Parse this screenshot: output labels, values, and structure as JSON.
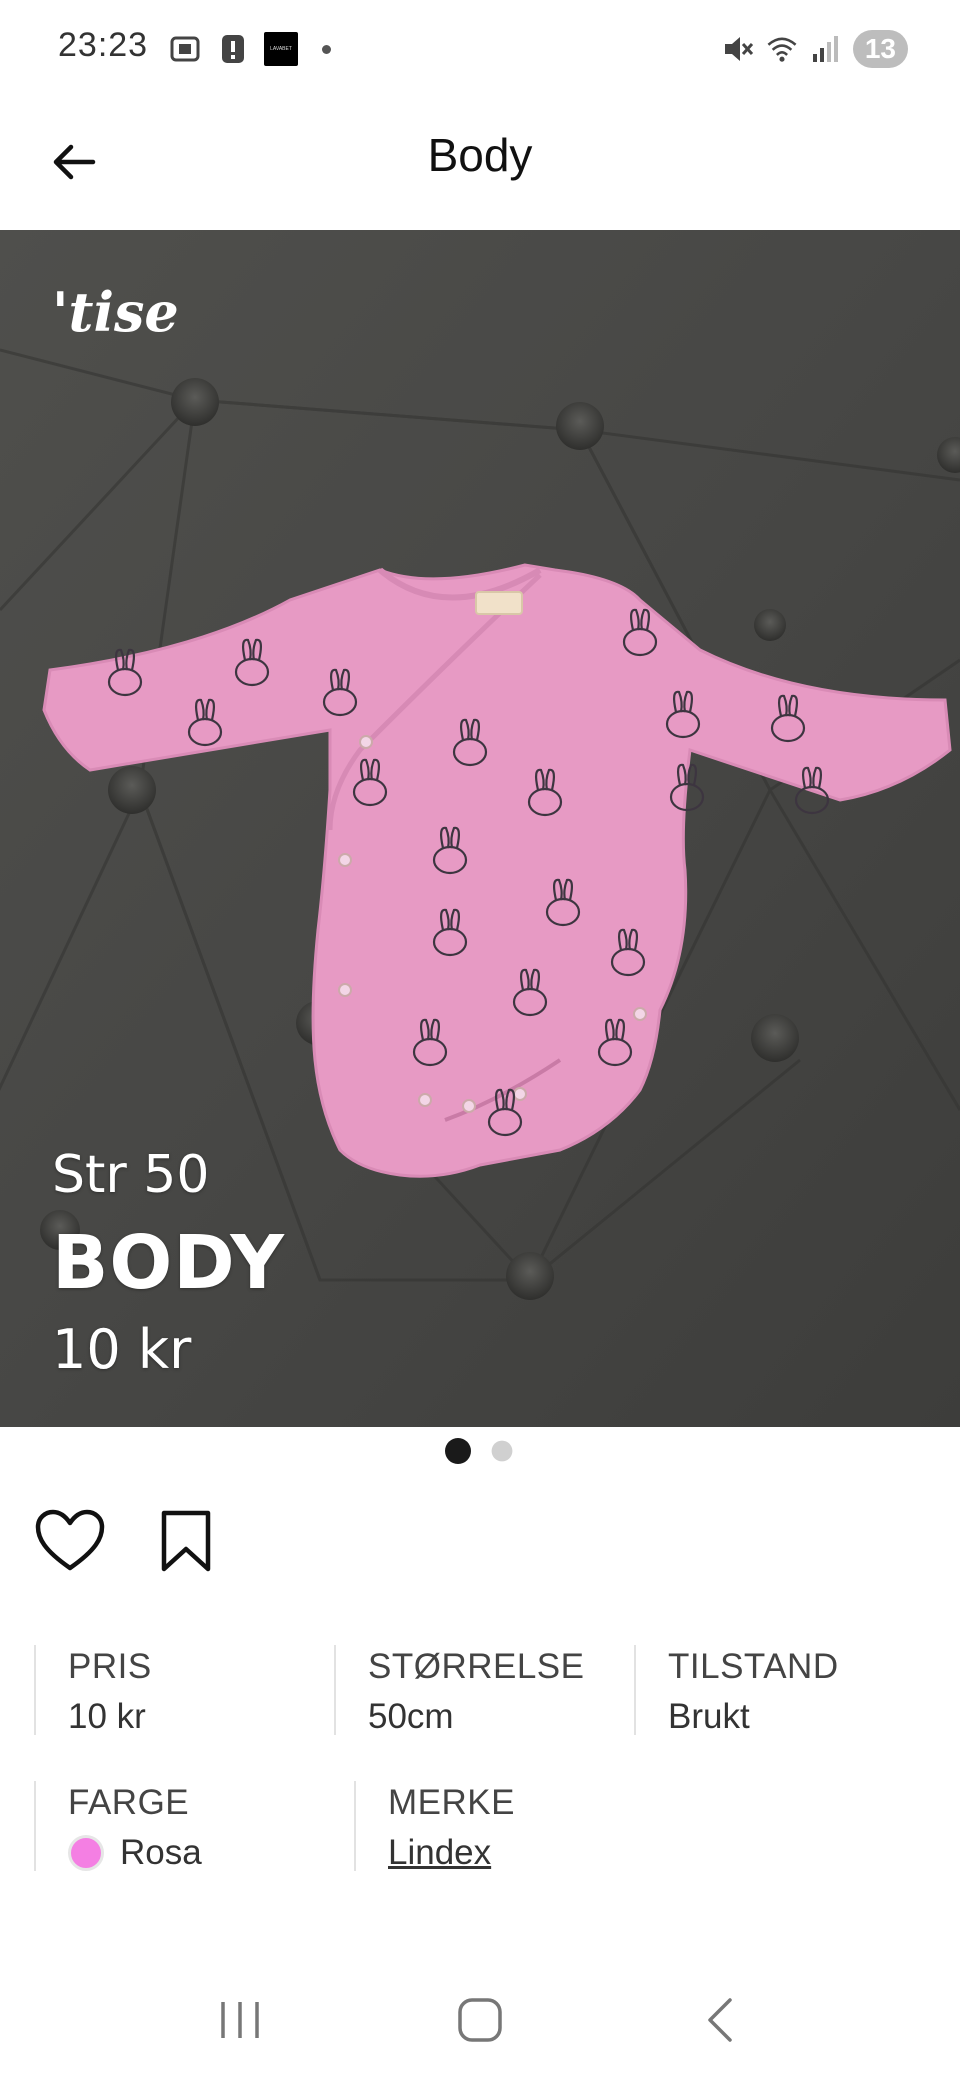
{
  "status_bar": {
    "time": "23:23",
    "notification_count": "13",
    "left_icons": [
      "screenshot-icon",
      "alert-icon",
      "app-thumbnail-icon"
    ],
    "right_icons": [
      "mute-icon",
      "wifi-icon",
      "signal-icon"
    ]
  },
  "header": {
    "title": "Body",
    "back_icon": "arrow-left-icon"
  },
  "image": {
    "logo": "'tise",
    "overlay_size": "Str 50",
    "overlay_title": "BODY",
    "overlay_price": "10 kr",
    "background_color": "#4b4b49",
    "garment_color": "#e79ac4"
  },
  "carousel": {
    "page_count": 2,
    "active_index": 0
  },
  "actions": {
    "like_icon": "heart-icon",
    "save_icon": "bookmark-icon"
  },
  "details": {
    "price": {
      "label": "PRIS",
      "value": "10 kr"
    },
    "size": {
      "label": "STØRRELSE",
      "value": "50cm"
    },
    "condition": {
      "label": "TILSTAND",
      "value": "Brukt"
    },
    "color": {
      "label": "FARGE",
      "value": "Rosa",
      "swatch": "#f47fe3"
    },
    "brand": {
      "label": "MERKE",
      "value": "Lindex"
    }
  },
  "nav_bar": {
    "icons": [
      "recents-icon",
      "home-icon",
      "back-icon"
    ]
  }
}
